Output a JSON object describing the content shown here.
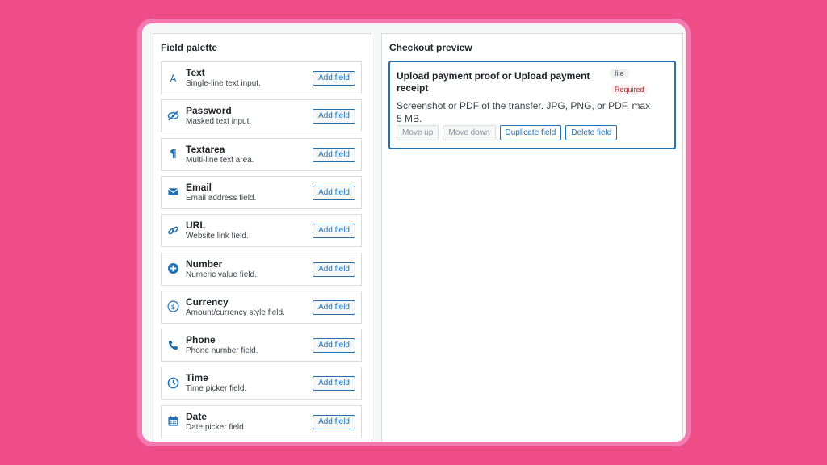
{
  "palette": {
    "title": "Field palette",
    "add_label": "Add field",
    "fields": [
      {
        "icon": "text-icon",
        "name": "Text",
        "desc": "Single-line text input."
      },
      {
        "icon": "password-icon",
        "name": "Password",
        "desc": "Masked text input."
      },
      {
        "icon": "paragraph-icon",
        "name": "Textarea",
        "desc": "Multi-line text area."
      },
      {
        "icon": "email-icon",
        "name": "Email",
        "desc": "Email address field."
      },
      {
        "icon": "link-icon",
        "name": "URL",
        "desc": "Website link field."
      },
      {
        "icon": "plus-circle-icon",
        "name": "Number",
        "desc": "Numeric value field."
      },
      {
        "icon": "dollar-icon",
        "name": "Currency",
        "desc": "Amount/currency style field."
      },
      {
        "icon": "phone-icon",
        "name": "Phone",
        "desc": "Phone number field."
      },
      {
        "icon": "clock-icon",
        "name": "Time",
        "desc": "Time picker field."
      },
      {
        "icon": "calendar-icon",
        "name": "Date",
        "desc": "Date picker field."
      }
    ]
  },
  "preview": {
    "title": "Checkout preview",
    "card": {
      "title": "Upload payment proof or Upload payment receipt",
      "type_badge": "file",
      "required_badge": "Required",
      "description": "Screenshot or PDF of the transfer. JPG, PNG, or PDF, max 5 MB.",
      "actions": {
        "move_up": "Move up",
        "move_down": "Move down",
        "duplicate": "Duplicate field",
        "delete": "Delete field"
      }
    }
  },
  "colors": {
    "background": "#ee4d87",
    "frame_border": "#f27ab0",
    "accent": "#2271b1",
    "required": "#b32d2e"
  }
}
